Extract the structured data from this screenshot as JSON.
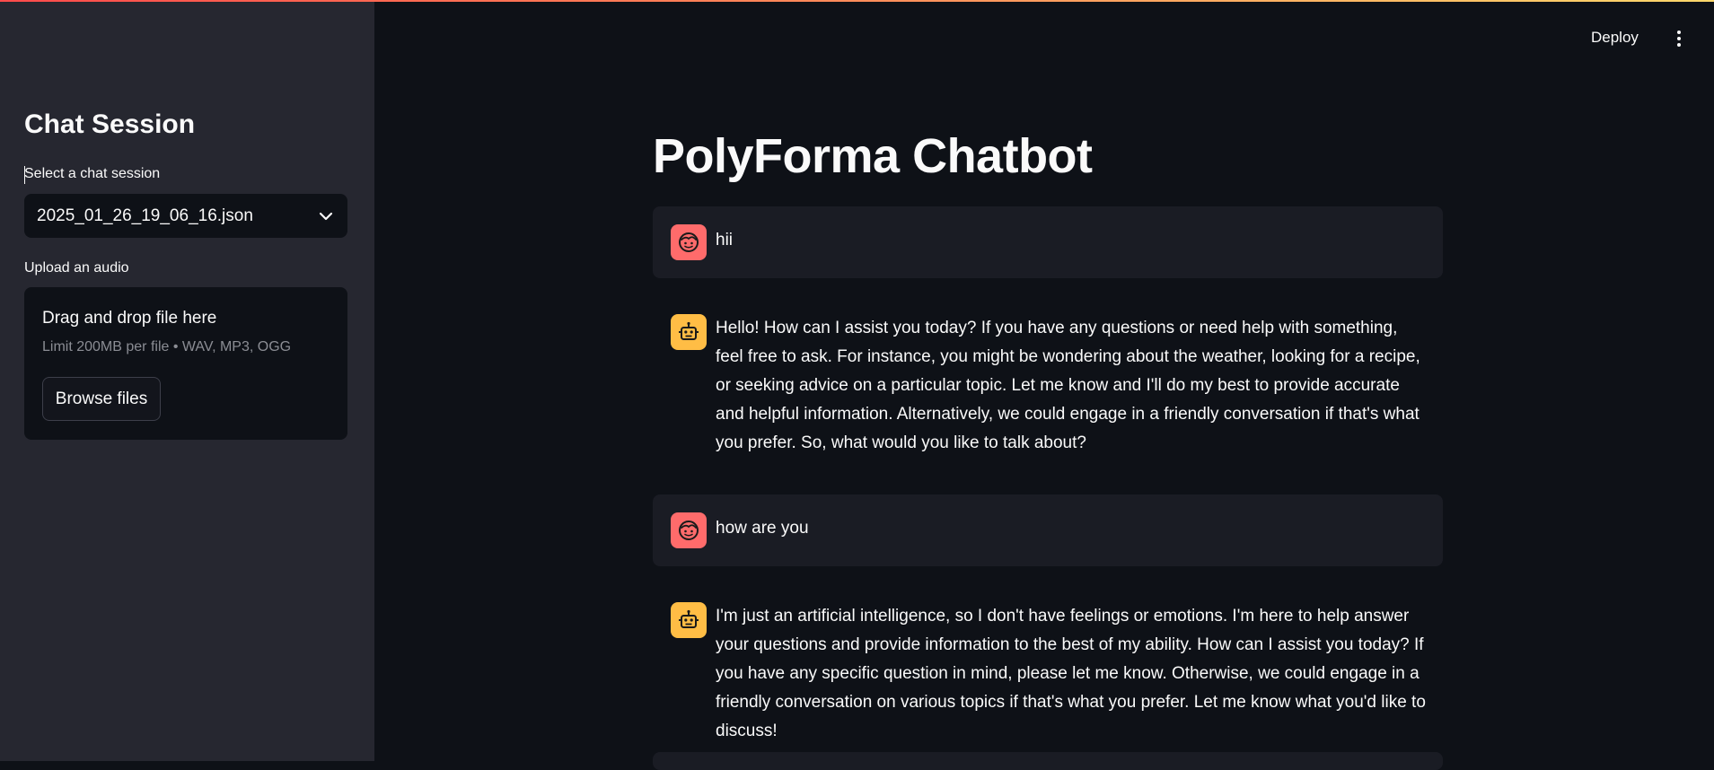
{
  "sidebar": {
    "title": "Chat Session",
    "session_label": "Select a chat session",
    "session_value": "2025_01_26_19_06_16.json",
    "upload_label": "Upload an audio",
    "dropzone": {
      "title": "Drag and drop file here",
      "limit": "Limit 200MB per file • WAV, MP3, OGG",
      "browse_label": "Browse files"
    }
  },
  "header": {
    "deploy_label": "Deploy",
    "menu_icon": "kebab-menu-icon"
  },
  "main": {
    "title": "PolyForma Chatbot",
    "messages": [
      {
        "role": "user",
        "icon": "user-face-icon",
        "text": "hii"
      },
      {
        "role": "assistant",
        "icon": "robot-icon",
        "text": "Hello! How can I assist you today? If you have any questions or need help with something, feel free to ask. For instance, you might be wondering about the weather, looking for a recipe, or seeking advice on a particular topic. Let me know and I'll do my best to provide accurate and helpful information. Alternatively, we could engage in a friendly conversation if that's what you prefer. So, what would you like to talk about?"
      },
      {
        "role": "user",
        "icon": "user-face-icon",
        "text": "how are you"
      },
      {
        "role": "assistant",
        "icon": "robot-icon",
        "text": "I'm just an artificial intelligence, so I don't have feelings or emotions. I'm here to help answer your questions and provide information to the best of my ability. How can I assist you today? If you have any specific question in mind, please let me know. Otherwise, we could engage in a friendly conversation on various topics if that's what you prefer. Let me know what you'd like to discuss!"
      }
    ]
  },
  "colors": {
    "sidebar_bg": "#262730",
    "main_bg": "#0e1117",
    "user_msg_bg": "#1a1c24",
    "user_avatar": "#ff6b6b",
    "bot_avatar": "#ffbd45"
  }
}
